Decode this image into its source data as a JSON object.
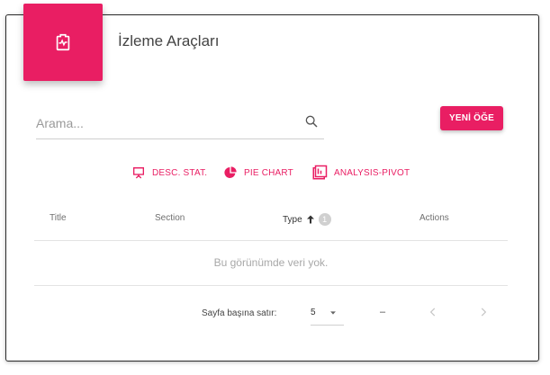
{
  "card": {
    "title": "İzleme Araçları"
  },
  "search": {
    "placeholder": "Arama..."
  },
  "actions": {
    "new_item_label": "YENİ ÖĞE"
  },
  "toolbar": {
    "items": [
      {
        "label": "DESC. STAT.",
        "icon": "presentation-icon"
      },
      {
        "label": "PIE CHART",
        "icon": "pie-chart-icon"
      },
      {
        "label": "ANALYSIS-PIVOT",
        "icon": "pivot-table-icon"
      }
    ]
  },
  "table": {
    "columns": [
      {
        "label": "Title"
      },
      {
        "label": "Section"
      },
      {
        "label": "Type",
        "sort_order": "1",
        "sort_direction": "ascending"
      },
      {
        "label": "Actions"
      }
    ],
    "empty_message": "Bu görünümde veri yok."
  },
  "pagination": {
    "rows_per_page_label": "Sayfa başına satır:",
    "rows_per_page_value": "5",
    "range_text": "–"
  },
  "colors": {
    "accent": "#e91e63"
  }
}
